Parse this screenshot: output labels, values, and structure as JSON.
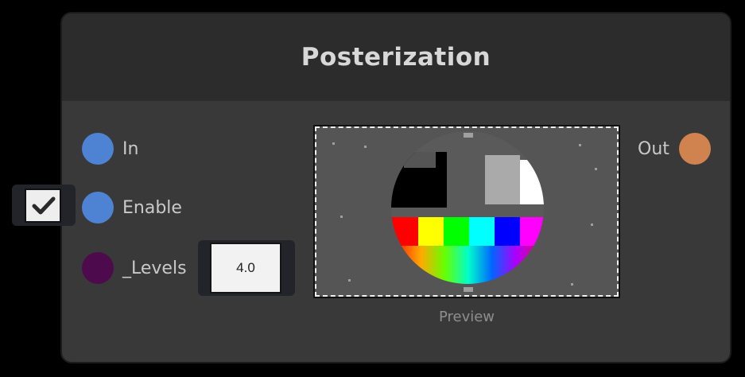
{
  "node": {
    "title": "Posterization"
  },
  "ports": {
    "inputs": [
      {
        "label": "In",
        "color": "#4e82d2"
      },
      {
        "label": "Enable",
        "color": "#4e82d2"
      },
      {
        "label": "_Levels",
        "color": "#4d0b4e"
      }
    ],
    "outputs": [
      {
        "label": "Out",
        "color": "#d1834f"
      }
    ]
  },
  "enable_checkbox": {
    "checked": true,
    "icon": "check-icon"
  },
  "levels_field": {
    "value": "4.0"
  },
  "preview": {
    "caption": "Preview",
    "bar_colors": [
      "#ff0000",
      "#ffff00",
      "#00ff00",
      "#00ffff",
      "#0000ff",
      "#ff00ff"
    ]
  }
}
